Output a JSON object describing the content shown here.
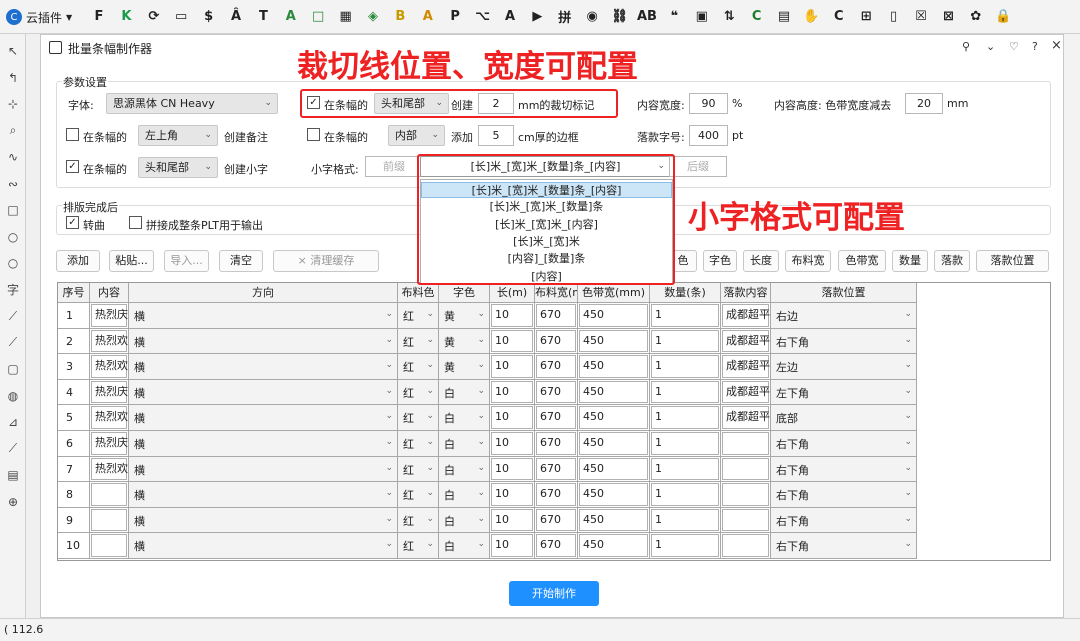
{
  "app": {
    "plugin_menu": "云插件",
    "status": "( 112.6"
  },
  "toolbar_icons": [
    "bold-f",
    "green-k",
    "rotate",
    "crop",
    "dollar",
    "a-hat",
    "t-shape",
    "a-outline",
    "square",
    "grid",
    "palette",
    "fill-b",
    "star-a",
    "pdf",
    "tree",
    "image-a",
    "video",
    "pin",
    "eye",
    "chain",
    "a-b",
    "quote",
    "image",
    "sort",
    "c-c",
    "cube",
    "pin-hand",
    "c-roll",
    "ruler",
    "doc",
    "doc-check",
    "x-box",
    "flower",
    "lock"
  ],
  "toolbar_texts": {
    "pin": "拼"
  },
  "dialog": {
    "title": "批量条幅制作器",
    "icons": [
      "pin-icon",
      "minimize-icon",
      "heart-icon",
      "help-icon",
      "close-icon"
    ],
    "help": "?",
    "close": "×"
  },
  "params": {
    "group_title": "参数设置",
    "font_label": "字体:",
    "font_value": "思源黑体 CN Heavy",
    "row1": {
      "checked": true,
      "label": "在条幅的",
      "pos": "头和尾部",
      "create": "创建",
      "num": "2",
      "unit": "mm的裁切标记"
    },
    "row2": {
      "checked": false,
      "label": "在条幅的",
      "pos": "左上角",
      "create": "创建备注"
    },
    "row2b": {
      "checked": false,
      "label": "在条幅的",
      "pos": "内部",
      "add": "添加",
      "num": "5",
      "unit": "cm厚的边框"
    },
    "row3": {
      "checked": true,
      "label": "在条幅的",
      "pos": "头和尾部",
      "create": "创建小字"
    },
    "small_format_label": "小字格式:",
    "prefix_placeholder": "前缀",
    "format_value": "[长]米_[宽]米_[数量]条_[内容]",
    "suffix_placeholder": "后缀",
    "content_width_label": "内容宽度:",
    "content_width": "90",
    "content_width_unit": "%",
    "content_height_label": "内容高度: 色带宽度减去",
    "content_height": "20",
    "content_height_unit": "mm",
    "sign_size_label": "落款字号:",
    "sign_size": "400",
    "sign_size_unit": "pt"
  },
  "after": {
    "group_title": "排版完成后",
    "curve_checked": true,
    "curve_label": "转曲",
    "merge_checked": false,
    "merge_label": "拼接成整条PLT用于输出"
  },
  "buttons": {
    "add": "添加",
    "paste": "粘贴...",
    "import": "导入...",
    "clear": "清空",
    "clear_cache": "× 清理缓存",
    "set_color": "色",
    "font_color": "字色",
    "length": "长度",
    "cloth_width": "布料宽",
    "band_width": "色带宽",
    "quantity": "数量",
    "signature": "落款",
    "signature_pos": "落款位置"
  },
  "format_options": [
    "[长]米_[宽]米_[数量]条_[内容]",
    "[长]米_[宽]米_[数量]条",
    "[长]米_[宽]米_[内容]",
    "[长]米_[宽]米",
    "[内容]_[数量]条",
    "[内容]"
  ],
  "annotations": {
    "top": "裁切线位置、宽度可配置",
    "right": "小字格式可配置"
  },
  "table": {
    "headers": [
      "序号",
      "内容",
      "方向",
      "布料色",
      "字色",
      "长(m)",
      "布料宽(mm)",
      "色带宽(mm)",
      "数量(条)",
      "落款内容",
      "落款位置"
    ],
    "rows": [
      [
        "1",
        "热烈庆祝超平面云插件正式发布上线",
        "横",
        "红",
        "黄",
        "10",
        "670",
        "450",
        "1",
        "成都超平面科技右边落款",
        "右边"
      ],
      [
        "2",
        "热烈欢迎各位老板体验使用超平面云插件",
        "横",
        "红",
        "黄",
        "10",
        "670",
        "450",
        "1",
        "成都超平面科技右下角落款",
        "右下角"
      ],
      [
        "3",
        "热烈欢迎各位老板莅临CDR资源网",
        "横",
        "红",
        "黄",
        "10",
        "670",
        "450",
        "1",
        "成都超平面科技左边落款",
        "左边"
      ],
      [
        "4",
        "热烈庆祝超平面云插件正式发布上线",
        "横",
        "红",
        "白",
        "10",
        "670",
        "450",
        "1",
        "成都超平面科技左下角落款",
        "左下角"
      ],
      [
        "5",
        "热烈欢迎各位老板体验使用超平面云插件",
        "横",
        "红",
        "白",
        "10",
        "670",
        "450",
        "1",
        "成都超平面科技底部落款",
        "底部"
      ],
      [
        "6",
        "热烈庆祝超平面云插件正式发布上线",
        "横",
        "红",
        "白",
        "10",
        "670",
        "450",
        "1",
        "",
        "右下角"
      ],
      [
        "7",
        "热烈欢迎各位老板体验使用超平面云插件",
        "横",
        "红",
        "白",
        "10",
        "670",
        "450",
        "1",
        "",
        "右下角"
      ],
      [
        "8",
        "",
        "横",
        "红",
        "白",
        "10",
        "670",
        "450",
        "1",
        "",
        "右下角"
      ],
      [
        "9",
        "",
        "横",
        "红",
        "白",
        "10",
        "670",
        "450",
        "1",
        "",
        "右下角"
      ],
      [
        "10",
        "",
        "横",
        "红",
        "白",
        "10",
        "670",
        "450",
        "1",
        "",
        "右下角"
      ]
    ]
  },
  "start_button": "开始制作",
  "colors": {
    "accent": "#1e90ff",
    "annotation": "#e22222"
  }
}
